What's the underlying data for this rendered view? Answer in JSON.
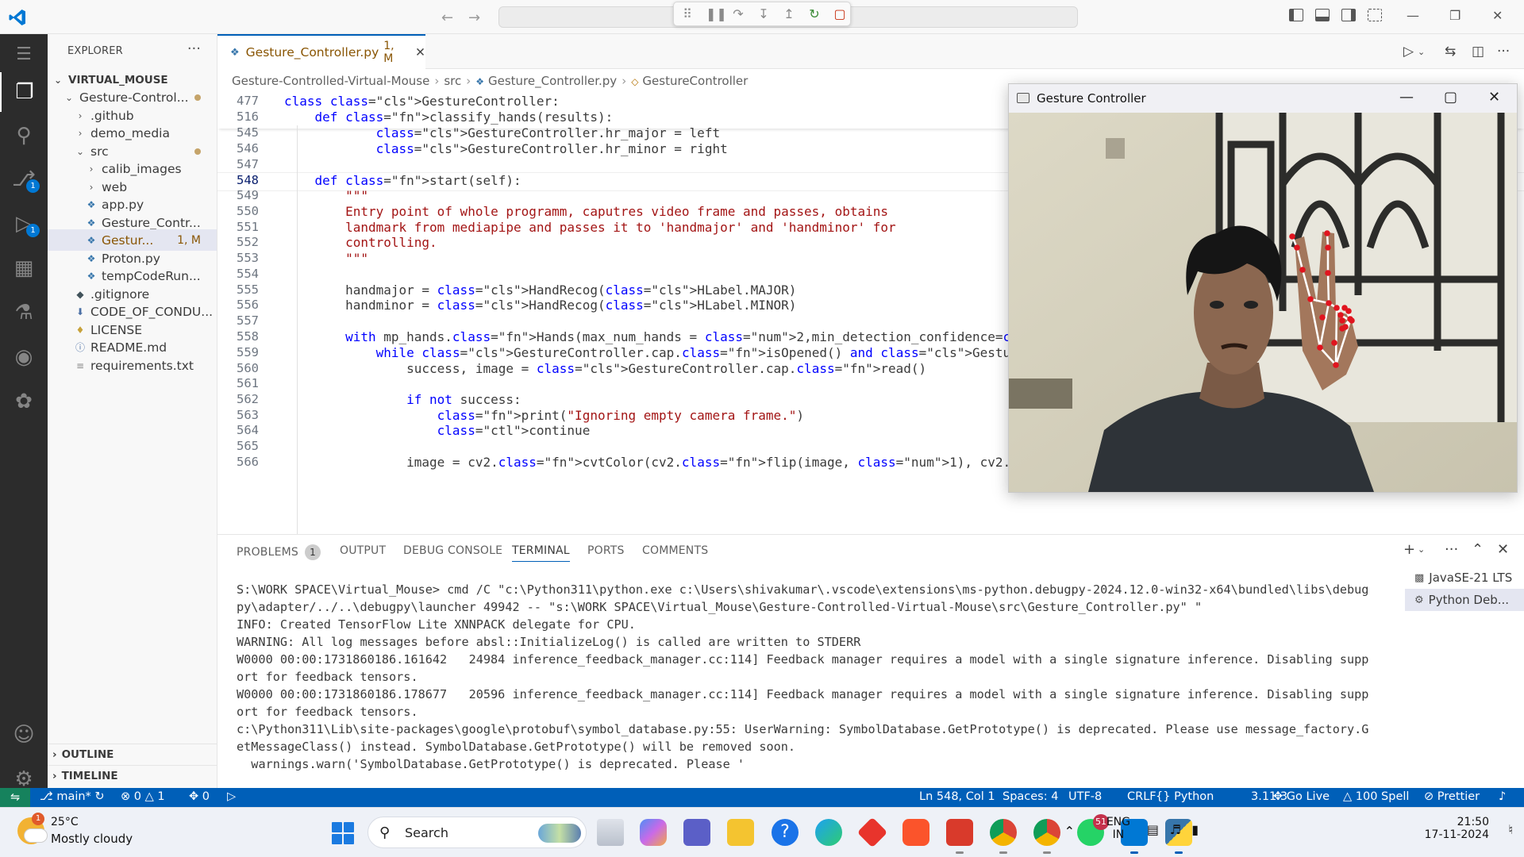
{
  "titlebar": {
    "back_icon": "arrow-left-icon",
    "forward_icon": "arrow-right-icon",
    "debug_toolbar": [
      "gripper-icon",
      "pause-icon",
      "step-over-icon",
      "step-into-icon",
      "step-out-icon",
      "restart-icon",
      "stop-icon"
    ]
  },
  "activity": {
    "scm_badge": "1",
    "debug_badge": "1"
  },
  "sidebar": {
    "title": "EXPLORER",
    "more": "···",
    "root": "VIRTUAL_MOUSE",
    "items": [
      {
        "label": "Gesture-Control...",
        "depth": 1,
        "kind": "folder-open"
      },
      {
        "label": ".github",
        "depth": 2,
        "kind": "folder"
      },
      {
        "label": "demo_media",
        "depth": 2,
        "kind": "folder"
      },
      {
        "label": "src",
        "depth": 2,
        "kind": "folder-open"
      },
      {
        "label": "calib_images",
        "depth": 3,
        "kind": "folder"
      },
      {
        "label": "web",
        "depth": 3,
        "kind": "folder"
      },
      {
        "label": "app.py",
        "depth": 3,
        "kind": "py"
      },
      {
        "label": "Gesture_Contr...",
        "depth": 3,
        "kind": "py"
      },
      {
        "label": "Gestur...",
        "depth": 3,
        "kind": "py",
        "status": "1, M"
      },
      {
        "label": "Proton.py",
        "depth": 3,
        "kind": "py"
      },
      {
        "label": "tempCodeRun...",
        "depth": 3,
        "kind": "py"
      },
      {
        "label": ".gitignore",
        "depth": 2,
        "kind": "git"
      },
      {
        "label": "CODE_OF_CONDU...",
        "depth": 2,
        "kind": "md"
      },
      {
        "label": "LICENSE",
        "depth": 2,
        "kind": "license"
      },
      {
        "label": "README.md",
        "depth": 2,
        "kind": "info"
      },
      {
        "label": "requirements.txt",
        "depth": 2,
        "kind": "txt"
      }
    ],
    "outline": "OUTLINE",
    "timeline": "TIMELINE"
  },
  "editor": {
    "tab_label": "Gesture_Controller.py",
    "tab_status": "1, M",
    "breadcrumb": [
      "Gesture-Controlled-Virtual-Mouse",
      "src",
      "Gesture_Controller.py",
      "GestureController"
    ],
    "lines": [
      {
        "n": "477",
        "t": "class GestureController:"
      },
      {
        "n": "516",
        "t": "    def classify_hands(results):"
      },
      {
        "n": "545",
        "t": "            GestureController.hr_major = left"
      },
      {
        "n": "546",
        "t": "            GestureController.hr_minor = right"
      },
      {
        "n": "547",
        "t": ""
      },
      {
        "n": "548",
        "t": "    def start(self):"
      },
      {
        "n": "549",
        "t": "        \"\"\""
      },
      {
        "n": "550",
        "t": "        Entry point of whole programm, caputres video frame and passes, obtains"
      },
      {
        "n": "551",
        "t": "        landmark from mediapipe and passes it to 'handmajor' and 'handminor' for"
      },
      {
        "n": "552",
        "t": "        controlling."
      },
      {
        "n": "553",
        "t": "        \"\"\""
      },
      {
        "n": "554",
        "t": ""
      },
      {
        "n": "555",
        "t": "        handmajor = HandRecog(HLabel.MAJOR)"
      },
      {
        "n": "556",
        "t": "        handminor = HandRecog(HLabel.MINOR)"
      },
      {
        "n": "557",
        "t": ""
      },
      {
        "n": "558",
        "t": "        with mp_hands.Hands(max_num_hands = 2,min_detection_confidence=0.5, min_tracking_confid"
      },
      {
        "n": "559",
        "t": "            while GestureController.cap.isOpened() and GestureController.gc_mode:"
      },
      {
        "n": "560",
        "t": "                success, image = GestureController.cap.read()"
      },
      {
        "n": "561",
        "t": ""
      },
      {
        "n": "562",
        "t": "                if not success:"
      },
      {
        "n": "563",
        "t": "                    print(\"Ignoring empty camera frame.\")"
      },
      {
        "n": "564",
        "t": "                    continue"
      },
      {
        "n": "565",
        "t": ""
      },
      {
        "n": "566",
        "t": "                image = cv2.cvtColor(cv2.flip(image, 1), cv2.COLOR_BGR2RGB)"
      }
    ]
  },
  "panel": {
    "tabs": [
      "PROBLEMS",
      "OUTPUT",
      "DEBUG CONSOLE",
      "TERMINAL",
      "PORTS",
      "COMMENTS"
    ],
    "problems_count": "1",
    "active_tab": "TERMINAL",
    "terminal": "S:\\WORK SPACE\\Virtual_Mouse> cmd /C \"c:\\Python311\\python.exe c:\\Users\\shivakumar\\.vscode\\extensions\\ms-python.debugpy-2024.12.0-win32-x64\\bundled\\libs\\debugpy\\adapter/../..\\debugpy\\launcher 49942 -- \"s:\\WORK SPACE\\Virtual_Mouse\\Gesture-Controlled-Virtual-Mouse\\src\\Gesture_Controller.py\" \"\nINFO: Created TensorFlow Lite XNNPACK delegate for CPU.\nWARNING: All log messages before absl::InitializeLog() is called are written to STDERR\nW0000 00:00:1731860186.161642   24984 inference_feedback_manager.cc:114] Feedback manager requires a model with a single signature inference. Disabling support for feedback tensors.\nW0000 00:00:1731860186.178677   20596 inference_feedback_manager.cc:114] Feedback manager requires a model with a single signature inference. Disabling support for feedback tensors.\nc:\\Python311\\Lib\\site-packages\\google\\protobuf\\symbol_database.py:55: UserWarning: SymbolDatabase.GetPrototype() is deprecated. Please use message_factory.GetMessageClass() instead. SymbolDatabase.GetPrototype() will be removed soon.\n  warnings.warn('SymbolDatabase.GetPrototype() is deprecated. Please '",
    "terminals": [
      "JavaSE-21 LTS",
      "Python Deb..."
    ]
  },
  "statusbar": {
    "branch": "main*",
    "errors": "0",
    "warnings": "1",
    "ports": "0",
    "position": "Ln 548, Col 1",
    "spaces": "Spaces: 4",
    "encoding": "UTF-8",
    "eol": "CRLF",
    "language": "Python",
    "version": "3.11.3",
    "golive": "Go Live",
    "spell": "100 Spell",
    "prettier": "Prettier"
  },
  "gesture_window": {
    "title": "Gesture Controller"
  },
  "taskbar": {
    "temp": "25°C",
    "weather": "Mostly cloudy",
    "weather_badge": "1",
    "search": "Search",
    "lang_top": "ENG",
    "lang_bottom": "IN",
    "time": "21:50",
    "date": "17-11-2024",
    "whatsapp_count": "51"
  },
  "colors": {
    "accent": "#005fb8",
    "status_remote": "#16825d",
    "activity_bg": "#2c2c2c",
    "landmark": "#e0141e"
  }
}
